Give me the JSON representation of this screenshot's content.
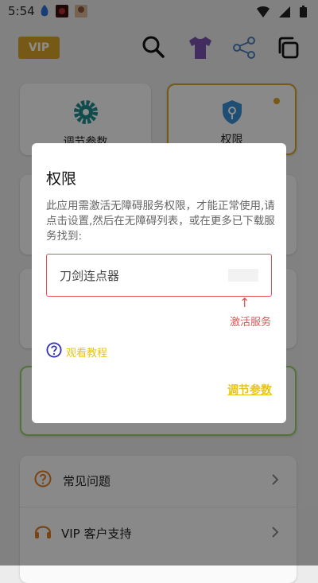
{
  "status_bar": {
    "time": "5:54"
  },
  "header": {
    "vip_label": "VIP",
    "icons": [
      "search-icon",
      "shirt-icon",
      "share-icon",
      "copy-icon"
    ],
    "accent_color": "#d7a326"
  },
  "cards": {
    "adjust_params_label": "调节参数",
    "permission_label": "权限"
  },
  "list": {
    "faq_label": "常见问题",
    "vip_support_label": "VIP 客户支持"
  },
  "dialog": {
    "title": "权限",
    "message": "此应用需激活无障碍服务权限，才能正常使用,请点击设置,然后在无障碍列表，或在更多已下载服务找到:",
    "service_name": "刀剑连点器",
    "arrow": "↑",
    "activate_hint": "激活服务",
    "tutorial_label": "观看教程",
    "adjust_params_link": "调节参数",
    "highlight_color": "#e15454",
    "link_color": "#e8c414"
  }
}
